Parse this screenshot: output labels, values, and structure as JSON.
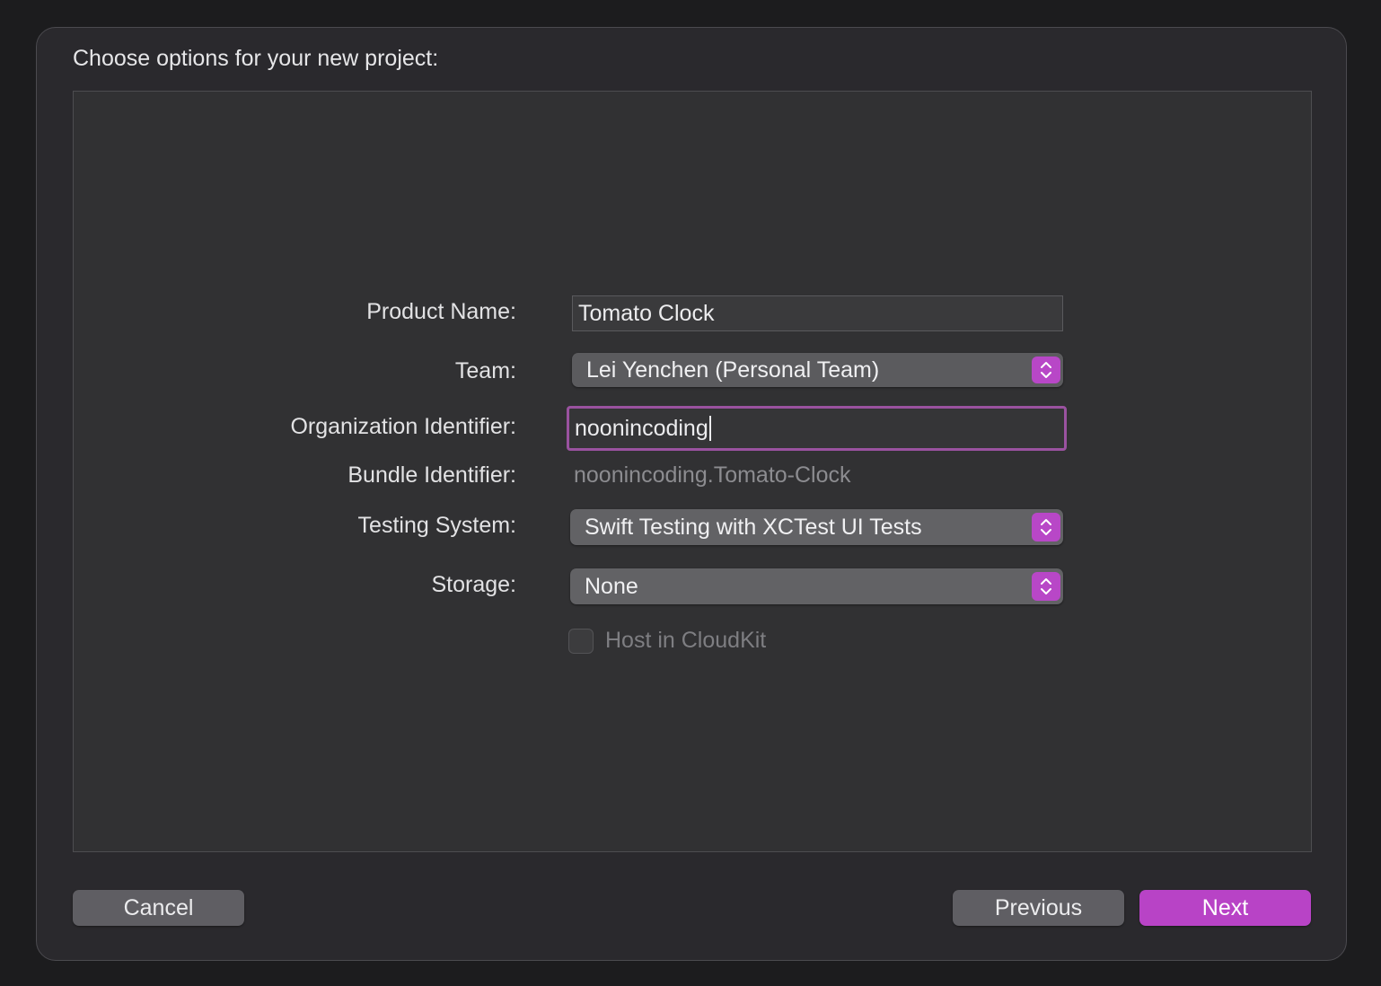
{
  "dialog": {
    "title": "Choose options for your new project:"
  },
  "form": {
    "product_name": {
      "label": "Product Name:",
      "value": "Tomato Clock"
    },
    "team": {
      "label": "Team:",
      "value": "Lei Yenchen (Personal Team)"
    },
    "organization_identifier": {
      "label": "Organization Identifier:",
      "value": "noonincoding"
    },
    "bundle_identifier": {
      "label": "Bundle Identifier:",
      "value": "noonincoding.Tomato-Clock"
    },
    "testing_system": {
      "label": "Testing System:",
      "value": "Swift Testing with XCTest UI Tests"
    },
    "storage": {
      "label": "Storage:",
      "value": "None"
    },
    "host_in_cloudkit": {
      "label": "Host in CloudKit",
      "checked": false,
      "enabled": false
    }
  },
  "buttons": {
    "cancel": "Cancel",
    "previous": "Previous",
    "next": "Next"
  },
  "colors": {
    "accent": "#b843c6",
    "focus_ring": "#9a52a0",
    "background": "#2a292d"
  },
  "icons": {
    "popup_indicator": "chevron-up-down-icon"
  }
}
